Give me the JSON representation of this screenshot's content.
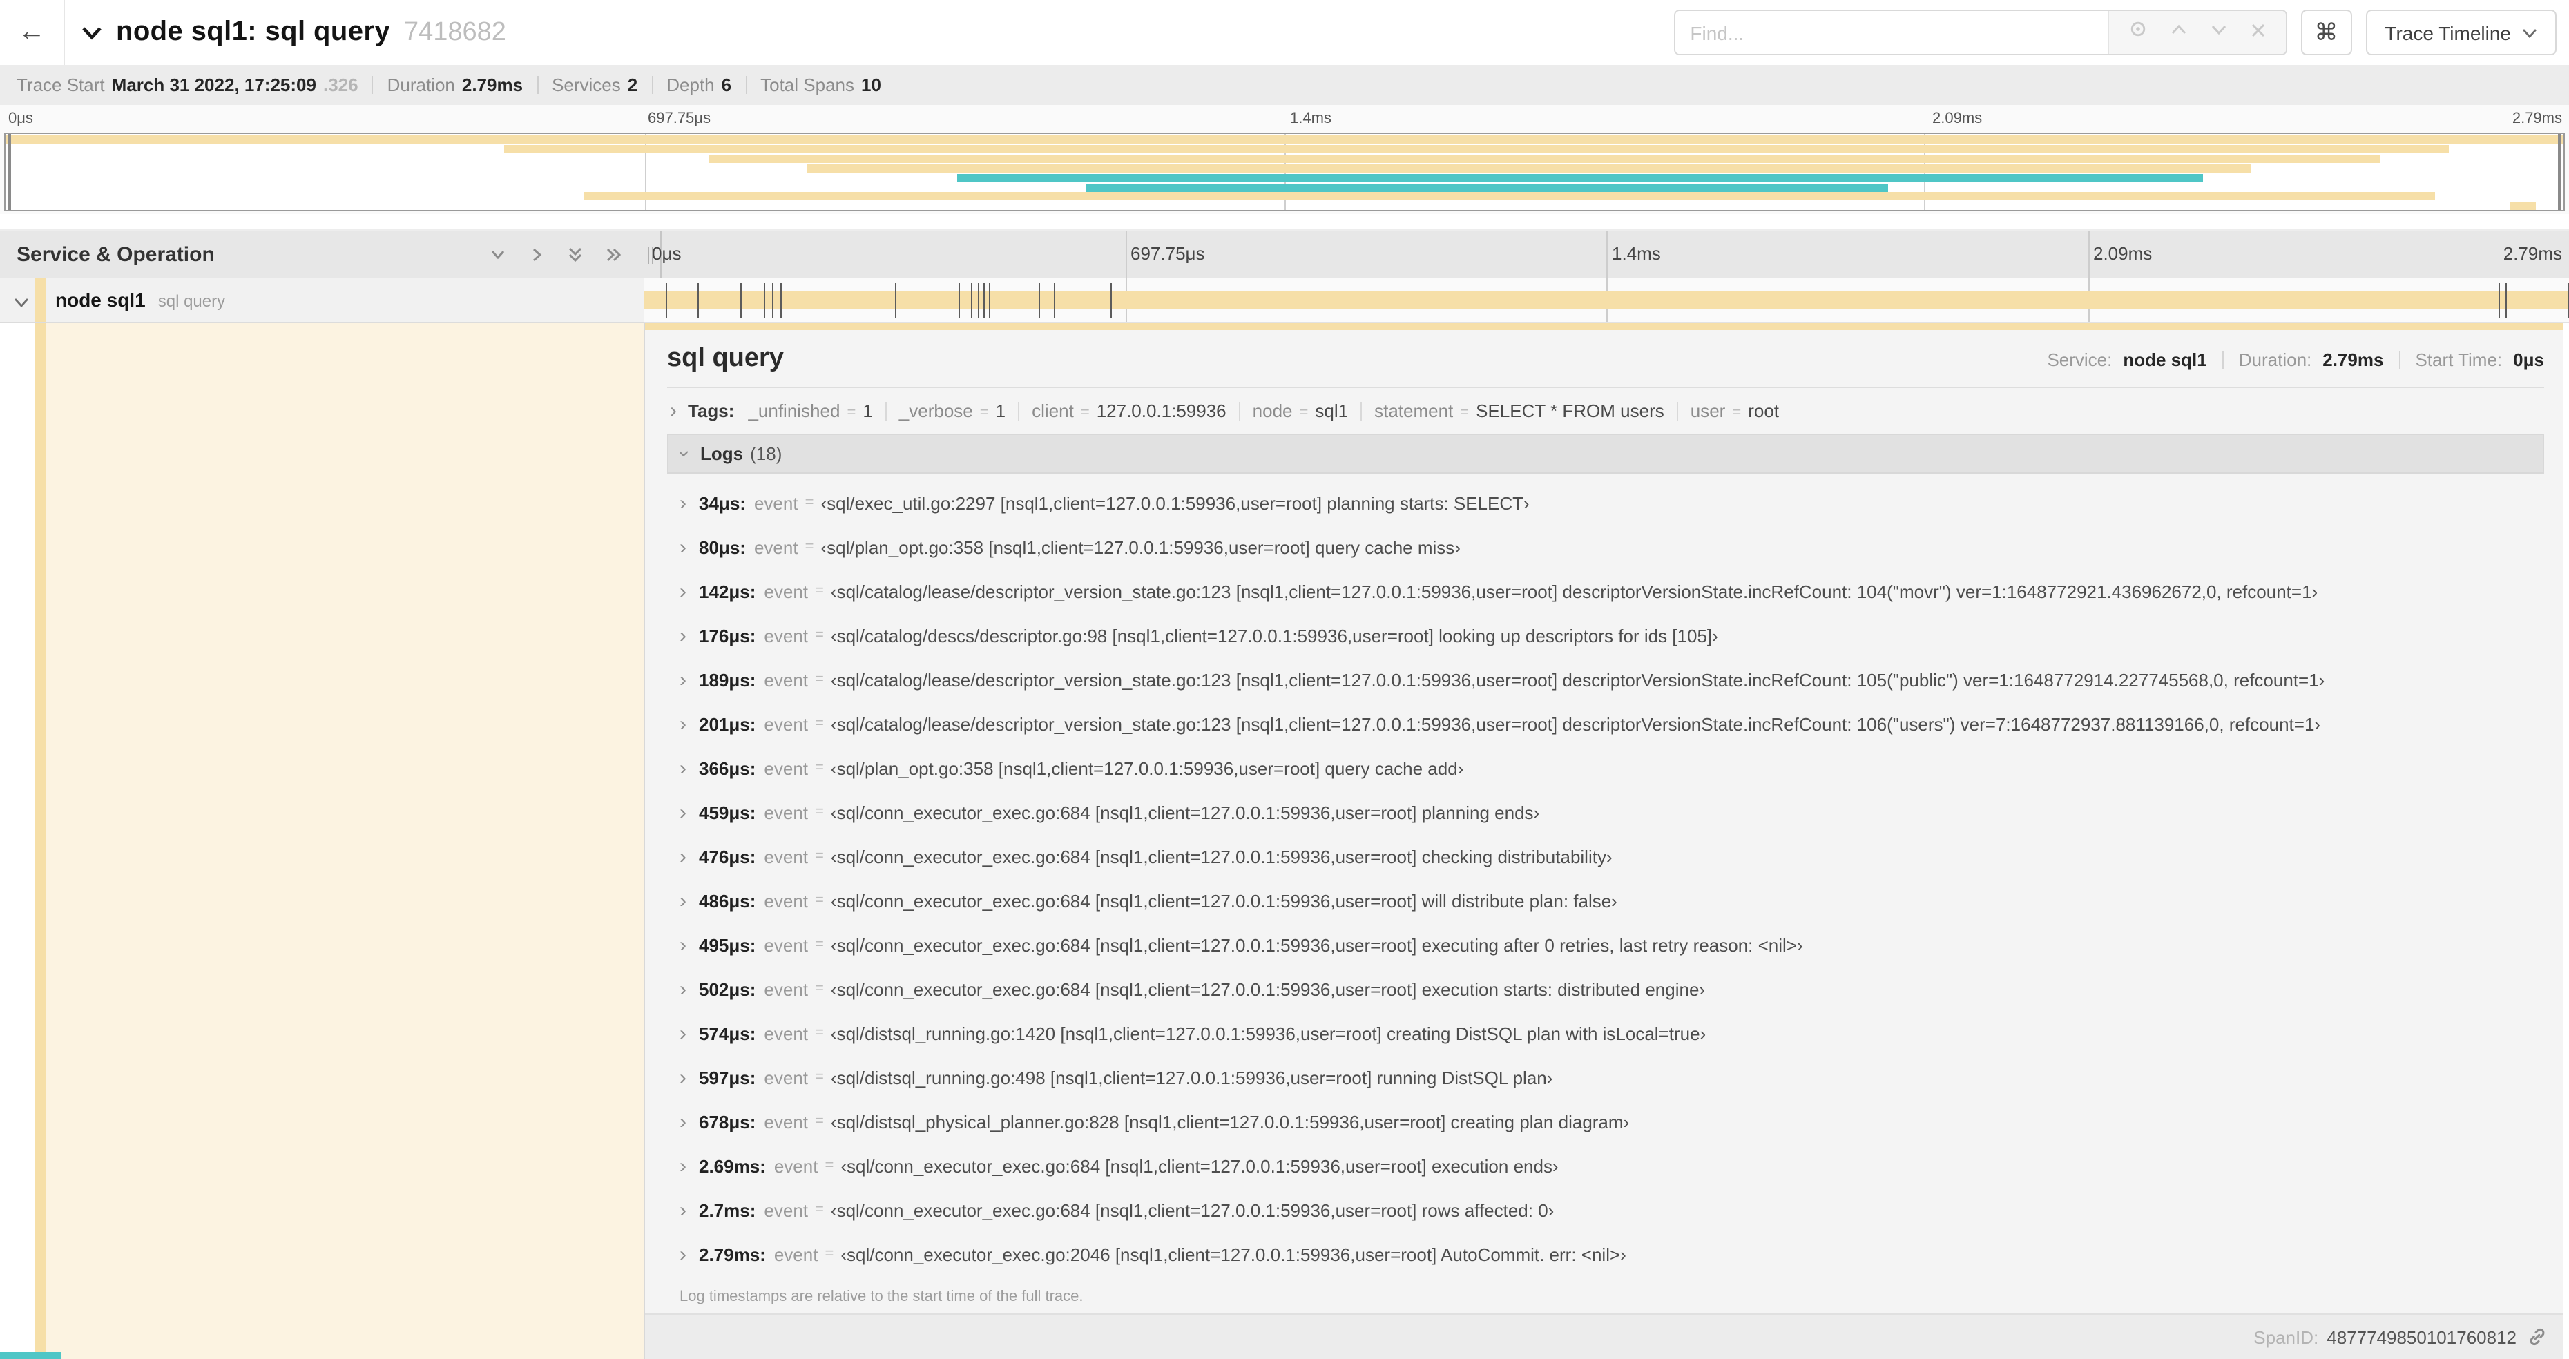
{
  "header": {
    "back_icon": "←",
    "title": "node sql1: sql query",
    "trace_id": "7418682",
    "find_placeholder": "Find...",
    "shortcut_key": "⌘",
    "view_selector": "Trace Timeline"
  },
  "trace_info": {
    "items": [
      {
        "label": "Trace Start",
        "value": "March 31 2022, 17:25:09",
        "suffix": ".326"
      },
      {
        "label": "Duration",
        "value": "2.79ms"
      },
      {
        "label": "Services",
        "value": "2"
      },
      {
        "label": "Depth",
        "value": "6"
      },
      {
        "label": "Total Spans",
        "value": "10"
      }
    ]
  },
  "colors": {
    "tan": "#f6dfa8",
    "teal": "#4fc6c6",
    "cream": "#fcf3e1"
  },
  "timeline": {
    "duration_us": 2790,
    "ticks": [
      {
        "label": "0μs",
        "pct": 0
      },
      {
        "label": "697.75μs",
        "pct": 25
      },
      {
        "label": "1.4ms",
        "pct": 50
      },
      {
        "label": "2.09ms",
        "pct": 75
      },
      {
        "label": "2.79ms",
        "pct": 100
      }
    ],
    "minimap_spans": [
      {
        "row": 0,
        "start_pct": 0,
        "end_pct": 100,
        "color": "tan"
      },
      {
        "row": 1,
        "start_pct": 19.5,
        "end_pct": 95.5,
        "color": "tan"
      },
      {
        "row": 2,
        "start_pct": 27.5,
        "end_pct": 92.8,
        "color": "tan"
      },
      {
        "row": 3,
        "start_pct": 31.3,
        "end_pct": 87.8,
        "color": "tan"
      },
      {
        "row": 4,
        "start_pct": 37.2,
        "end_pct": 85.9,
        "color": "teal"
      },
      {
        "row": 5,
        "start_pct": 42.2,
        "end_pct": 73.6,
        "color": "teal"
      },
      {
        "row": 6,
        "start_pct": 22.6,
        "end_pct": 95.0,
        "color": "tan"
      },
      {
        "row": 7,
        "start_pct": 97.9,
        "end_pct": 98.9,
        "color": "tan"
      }
    ]
  },
  "span_table": {
    "header": "Service & Operation",
    "row": {
      "service": "node sql1",
      "operation": "sql query",
      "bar_start_pct": 0,
      "bar_end_pct": 100
    }
  },
  "detail": {
    "title": "sql query",
    "meta": [
      {
        "label": "Service:",
        "value": "node sql1"
      },
      {
        "label": "Duration:",
        "value": "2.79ms"
      },
      {
        "label": "Start Time:",
        "value": "0μs"
      }
    ],
    "tags_label": "Tags:",
    "tags": [
      {
        "key": "_unfinished",
        "value": "1"
      },
      {
        "key": "_verbose",
        "value": "1"
      },
      {
        "key": "client",
        "value": "127.0.0.1:59936"
      },
      {
        "key": "node",
        "value": "sql1"
      },
      {
        "key": "statement",
        "value": "SELECT * FROM users"
      },
      {
        "key": "user",
        "value": "root"
      }
    ],
    "logs_label": "Logs",
    "logs_count": "(18)",
    "logs": [
      {
        "time": "34μs",
        "time_us": 34,
        "field": "event",
        "value": "‹sql/exec_util.go:2297 [nsql1,client=127.0.0.1:59936,user=root] planning starts: SELECT›"
      },
      {
        "time": "80μs",
        "time_us": 80,
        "field": "event",
        "value": "‹sql/plan_opt.go:358 [nsql1,client=127.0.0.1:59936,user=root] query cache miss›"
      },
      {
        "time": "142μs",
        "time_us": 142,
        "field": "event",
        "value": "‹sql/catalog/lease/descriptor_version_state.go:123 [nsql1,client=127.0.0.1:59936,user=root] descriptorVersionState.incRefCount: 104(\"movr\") ver=1:1648772921.436962672,0, refcount=1›"
      },
      {
        "time": "176μs",
        "time_us": 176,
        "field": "event",
        "value": "‹sql/catalog/descs/descriptor.go:98 [nsql1,client=127.0.0.1:59936,user=root] looking up descriptors for ids [105]›"
      },
      {
        "time": "189μs",
        "time_us": 189,
        "field": "event",
        "value": "‹sql/catalog/lease/descriptor_version_state.go:123 [nsql1,client=127.0.0.1:59936,user=root] descriptorVersionState.incRefCount: 105(\"public\") ver=1:1648772914.227745568,0, refcount=1›"
      },
      {
        "time": "201μs",
        "time_us": 201,
        "field": "event",
        "value": "‹sql/catalog/lease/descriptor_version_state.go:123 [nsql1,client=127.0.0.1:59936,user=root] descriptorVersionState.incRefCount: 106(\"users\") ver=7:1648772937.881139166,0, refcount=1›"
      },
      {
        "time": "366μs",
        "time_us": 366,
        "field": "event",
        "value": "‹sql/plan_opt.go:358 [nsql1,client=127.0.0.1:59936,user=root] query cache add›"
      },
      {
        "time": "459μs",
        "time_us": 459,
        "field": "event",
        "value": "‹sql/conn_executor_exec.go:684 [nsql1,client=127.0.0.1:59936,user=root] planning ends›"
      },
      {
        "time": "476μs",
        "time_us": 476,
        "field": "event",
        "value": "‹sql/conn_executor_exec.go:684 [nsql1,client=127.0.0.1:59936,user=root] checking distributability›"
      },
      {
        "time": "486μs",
        "time_us": 486,
        "field": "event",
        "value": "‹sql/conn_executor_exec.go:684 [nsql1,client=127.0.0.1:59936,user=root] will distribute plan: false›"
      },
      {
        "time": "495μs",
        "time_us": 495,
        "field": "event",
        "value": "‹sql/conn_executor_exec.go:684 [nsql1,client=127.0.0.1:59936,user=root] executing after 0 retries, last retry reason: <nil>›"
      },
      {
        "time": "502μs",
        "time_us": 502,
        "field": "event",
        "value": "‹sql/conn_executor_exec.go:684 [nsql1,client=127.0.0.1:59936,user=root] execution starts: distributed engine›"
      },
      {
        "time": "574μs",
        "time_us": 574,
        "field": "event",
        "value": "‹sql/distsql_running.go:1420 [nsql1,client=127.0.0.1:59936,user=root] creating DistSQL plan with isLocal=true›"
      },
      {
        "time": "597μs",
        "time_us": 597,
        "field": "event",
        "value": "‹sql/distsql_running.go:498 [nsql1,client=127.0.0.1:59936,user=root] running DistSQL plan›"
      },
      {
        "time": "678μs",
        "time_us": 678,
        "field": "event",
        "value": "‹sql/distsql_physical_planner.go:828 [nsql1,client=127.0.0.1:59936,user=root] creating plan diagram›"
      },
      {
        "time": "2.69ms",
        "time_us": 2690,
        "field": "event",
        "value": "‹sql/conn_executor_exec.go:684 [nsql1,client=127.0.0.1:59936,user=root] execution ends›"
      },
      {
        "time": "2.7ms",
        "time_us": 2700,
        "field": "event",
        "value": "‹sql/conn_executor_exec.go:684 [nsql1,client=127.0.0.1:59936,user=root] rows affected: 0›"
      },
      {
        "time": "2.79ms",
        "time_us": 2790,
        "field": "event",
        "value": "‹sql/conn_executor_exec.go:2046 [nsql1,client=127.0.0.1:59936,user=root] AutoCommit. err: <nil>›"
      }
    ],
    "footer_note": "Log timestamps are relative to the start time of the full trace.",
    "span_id_label": "SpanID:",
    "span_id": "4877749850101760812"
  }
}
